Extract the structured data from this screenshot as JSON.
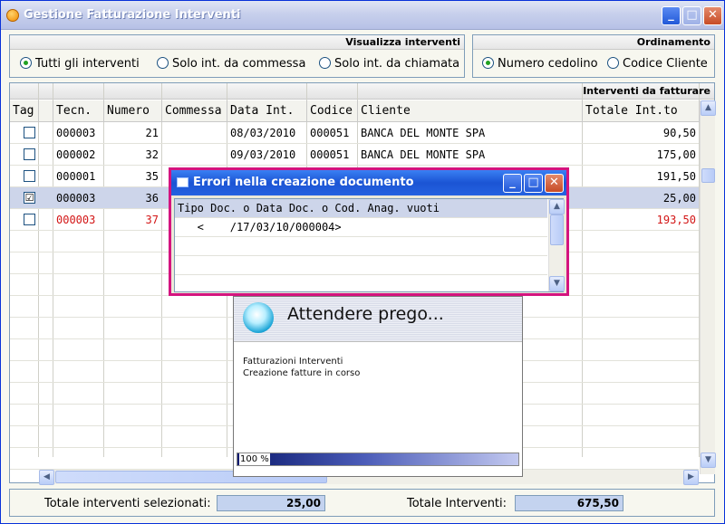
{
  "window": {
    "title": "Gestione Fatturazione Interventi",
    "buttons": {
      "minimize": "_",
      "maximize": "□",
      "close": "✕"
    }
  },
  "visualizza": {
    "header": "Visualizza interventi",
    "options": [
      "Tutti gli interventi",
      "Solo int. da commessa",
      "Solo int. da chiamata"
    ],
    "selected": "Tutti gli interventi"
  },
  "ordinamento": {
    "header": "Ordinamento",
    "options": [
      "Numero cedolino",
      "Codice Cliente"
    ],
    "selected": "Numero cedolino"
  },
  "grid": {
    "header": "Interventi da fatturare",
    "columns": [
      "Tag",
      "Tecn.",
      "Numero",
      "Commessa",
      "Data Int.",
      "Codice",
      "Cliente",
      "Totale Int.to"
    ],
    "rows": [
      {
        "tag": "",
        "tecn": "000003",
        "numero": "21",
        "commessa": "",
        "data": "08/03/2010",
        "codice": "000051",
        "cliente": "BANCA DEL MONTE SPA",
        "totale": "90,50"
      },
      {
        "tag": "",
        "tecn": "000002",
        "numero": "32",
        "commessa": "",
        "data": "09/03/2010",
        "codice": "000051",
        "cliente": "BANCA DEL MONTE SPA",
        "totale": "175,00"
      },
      {
        "tag": "",
        "tecn": "000001",
        "numero": "35",
        "commessa": "",
        "data": "",
        "codice": "",
        "cliente": "",
        "totale": "191,50"
      },
      {
        "tag": "☑",
        "tecn": "000003",
        "numero": "36",
        "commessa": "",
        "data": "",
        "codice": "",
        "cliente": "",
        "totale": "25,00"
      },
      {
        "tag": "",
        "tecn": "000003",
        "numero": "37",
        "commessa": "",
        "data": "",
        "codice": "",
        "cliente": "",
        "totale": "193,50"
      }
    ],
    "selected_row": 3,
    "red_row": 4
  },
  "footer": {
    "selected_label": "Totale interventi selezionati:",
    "selected_value": "25,00",
    "total_label": "Totale Interventi:",
    "total_value": "675,50"
  },
  "error_dialog": {
    "title": "Errori nella creazione documento",
    "lines": [
      "Tipo Doc. o Data Doc. o Cod. Anag. vuoti",
      "   <    /17/03/10/000004>"
    ]
  },
  "wait_dialog": {
    "title": "Attendere prego...",
    "line1": "Fatturazioni Interventi",
    "line2": "Creazione fatture in corso",
    "progress_text": "100 %",
    "progress": 1.0
  },
  "colors": {
    "selected_row": "#cdd5ea",
    "red_text": "#d31616",
    "dialog_border": "#d4147f"
  }
}
